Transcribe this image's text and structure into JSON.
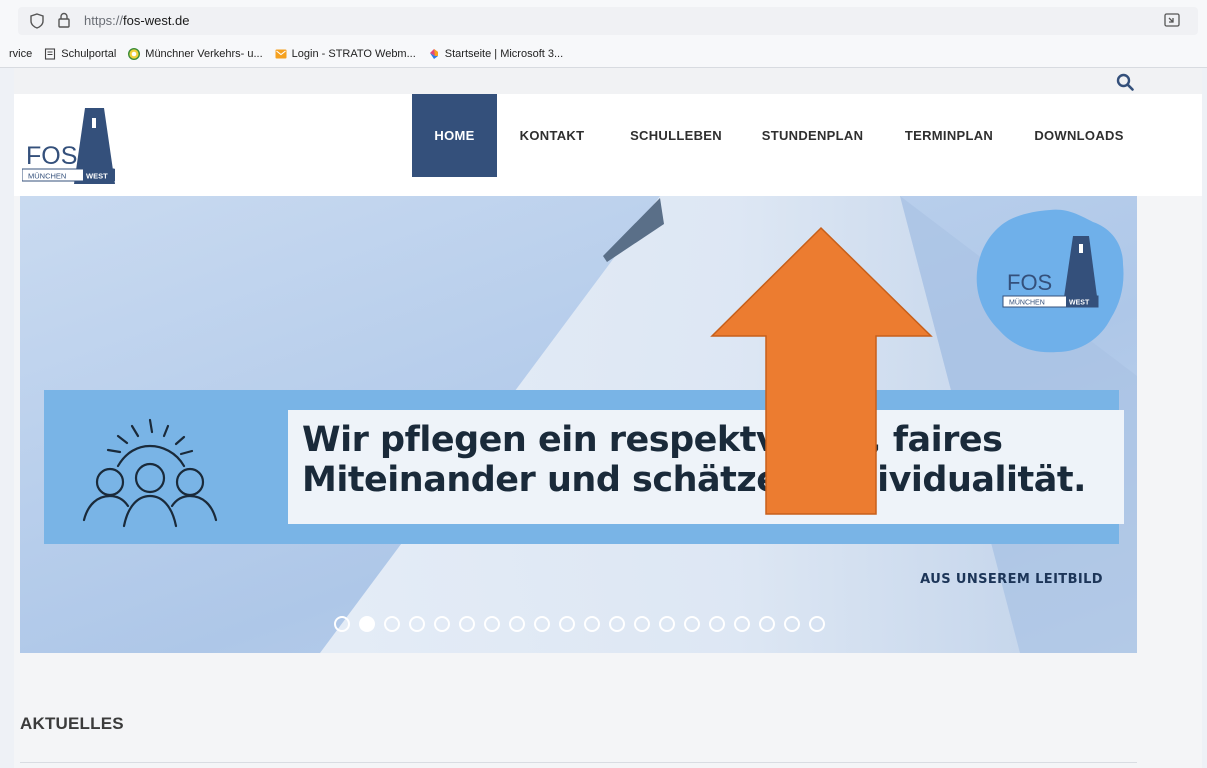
{
  "browser": {
    "url_protocol": "https://",
    "url_host": "fos-west.de",
    "bookmarks": [
      {
        "label": "rvice"
      },
      {
        "label": "Schulportal"
      },
      {
        "label": "Münchner Verkehrs- u..."
      },
      {
        "label": "Login - STRATO Webm..."
      },
      {
        "label": "Startseite | Microsoft 3..."
      }
    ]
  },
  "site": {
    "logo": {
      "text": "FOS",
      "sub_left": "MÜNCHEN",
      "sub_right": "WEST"
    },
    "nav": [
      {
        "label": "HOME",
        "active": true
      },
      {
        "label": "KONTAKT"
      },
      {
        "label": "SCHULLEBEN"
      },
      {
        "label": "STUNDENPLAN"
      },
      {
        "label": "TERMINPLAN"
      },
      {
        "label": "DOWNLOADS"
      }
    ],
    "hero": {
      "quote_line_1": "Wir pflegen ein respektvolles, faires",
      "quote_line_2": "Miteinander und schätzen Individualität.",
      "caption": "AUS UNSEREM LEITBILD",
      "badge": {
        "text": "FOS",
        "sub_left": "MÜNCHEN",
        "sub_right": "WEST"
      },
      "slide_count": 20,
      "active_slide": 2
    },
    "section_title": "AKTUELLES"
  },
  "annotation": {
    "type": "arrow",
    "color": "#ec7c30",
    "points_to": "STUNDENPLAN"
  },
  "colors": {
    "nav_active": "#34507b",
    "quote_band": "#79b4e6",
    "badge": "#6fb0ea",
    "arrow": "#ec7c30"
  }
}
